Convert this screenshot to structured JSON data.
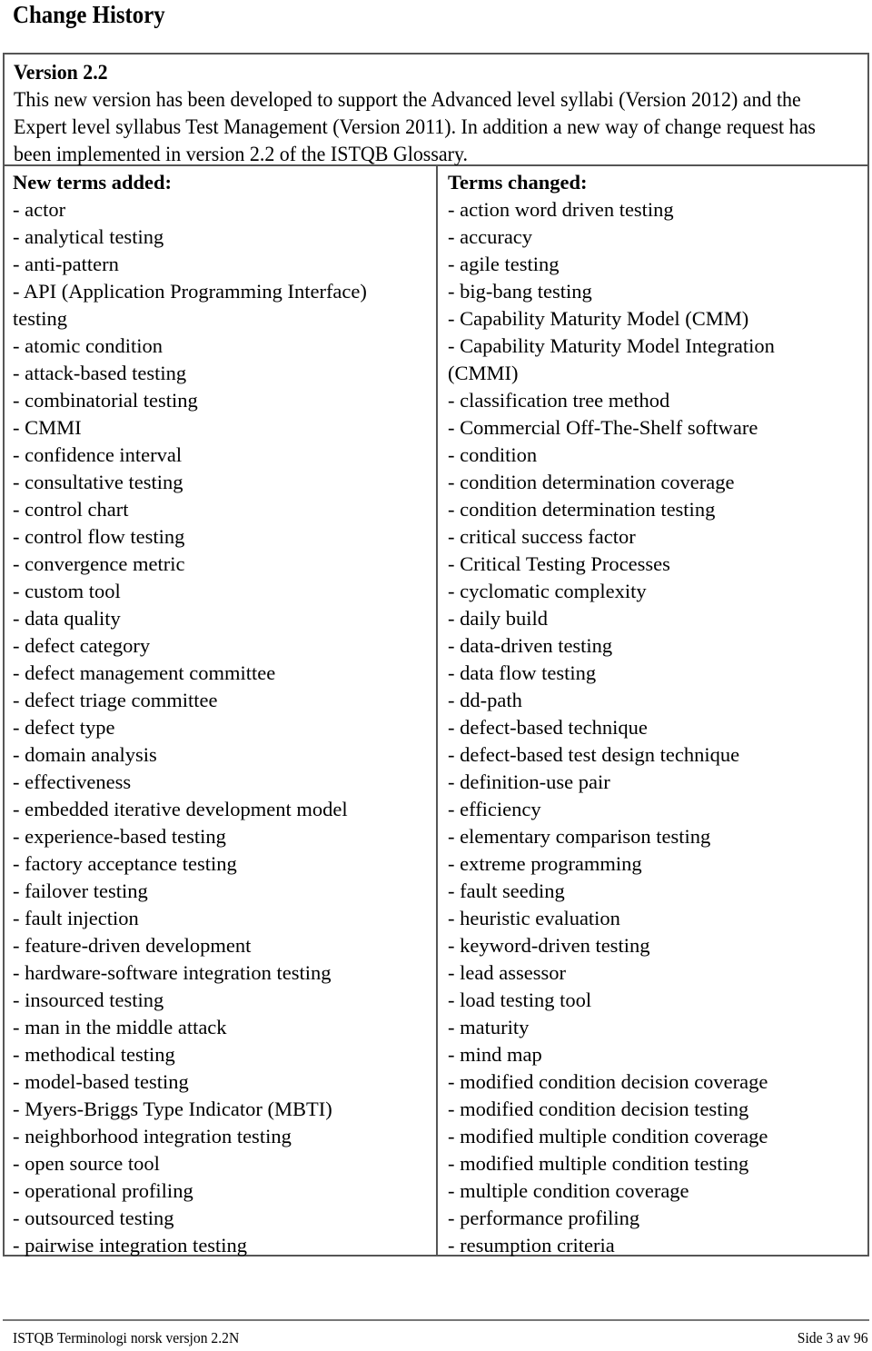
{
  "page_title": "Change History",
  "version": {
    "heading": "Version 2.2",
    "description": "This new version has been developed to support the Advanced level syllabi (Version 2012) and the Expert level syllabus Test Management (Version 2011). In addition a new way of change request has been implemented in version 2.2 of the ISTQB Glossary."
  },
  "new_terms": {
    "heading": "New terms added:",
    "items": [
      "- actor",
      "- analytical testing",
      "- anti-pattern",
      "- API (Application Programming Interface)",
      "testing",
      "- atomic condition",
      "- attack-based testing",
      "- combinatorial testing",
      "- CMMI",
      "- confidence interval",
      "- consultative testing",
      "- control chart",
      "- control flow testing",
      "- convergence metric",
      "- custom tool",
      "- data quality",
      "- defect category",
      "- defect management committee",
      "- defect triage committee",
      "- defect type",
      "- domain analysis",
      "- effectiveness",
      "- embedded iterative development model",
      "- experience-based testing",
      "- factory acceptance testing",
      "- failover testing",
      "- fault injection",
      "- feature-driven development",
      "- hardware-software integration testing",
      "- insourced testing",
      "- man in the middle attack",
      "- methodical testing",
      "- model-based testing",
      "- Myers-Briggs Type Indicator (MBTI)",
      "- neighborhood integration testing",
      "- open source tool",
      "- operational profiling",
      "- outsourced testing",
      "- pairwise integration testing"
    ]
  },
  "changed_terms": {
    "heading": "Terms changed:",
    "items": [
      "- action word driven testing",
      "- accuracy",
      "- agile testing",
      "- big-bang testing",
      "- Capability Maturity Model (CMM)",
      "- Capability Maturity Model Integration",
      "(CMMI)",
      "- classification tree method",
      "- Commercial Off-The-Shelf software",
      "- condition",
      "- condition determination coverage",
      "- condition determination testing",
      "- critical success factor",
      "- Critical Testing Processes",
      "- cyclomatic complexity",
      "- daily build",
      "- data-driven testing",
      "- data flow testing",
      "- dd-path",
      "- defect-based technique",
      "- defect-based test design technique",
      "- definition-use pair",
      "- efficiency",
      "- elementary comparison testing",
      "- extreme programming",
      "- fault seeding",
      "- heuristic evaluation",
      "- keyword-driven testing",
      "- lead assessor",
      "- load testing tool",
      "- maturity",
      "- mind map",
      "- modified condition decision coverage",
      "- modified condition decision testing",
      "- modified multiple condition coverage",
      "- modified multiple condition testing",
      "- multiple condition coverage",
      "- performance profiling",
      "- resumption criteria"
    ]
  },
  "footer": {
    "document_name": "ISTQB Terminologi norsk versjon 2.2N",
    "page_info": "Side 3 av 96"
  }
}
